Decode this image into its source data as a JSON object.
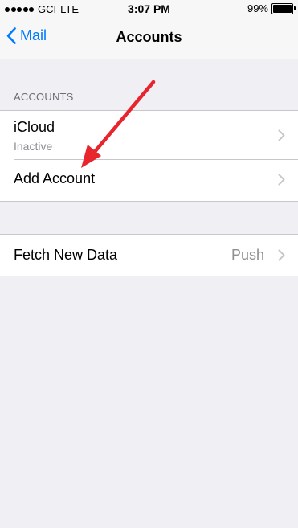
{
  "status_bar": {
    "carrier": "GCI",
    "network": "LTE",
    "time": "3:07 PM",
    "battery_text": "99%",
    "battery_level": 0.99
  },
  "nav": {
    "back_label": "Mail",
    "title": "Accounts"
  },
  "accounts_section": {
    "header": "ACCOUNTS",
    "items": [
      {
        "title": "iCloud",
        "subtitle": "Inactive"
      },
      {
        "title": "Add Account"
      }
    ]
  },
  "fetch_section": {
    "title": "Fetch New Data",
    "value": "Push"
  },
  "colors": {
    "accent": "#007aff",
    "background": "#efeff4",
    "annotation": "#e8242c"
  },
  "icons": {
    "back": "chevron-left-icon",
    "disclosure": "chevron-right-icon",
    "annotation": "red-arrow-icon"
  }
}
